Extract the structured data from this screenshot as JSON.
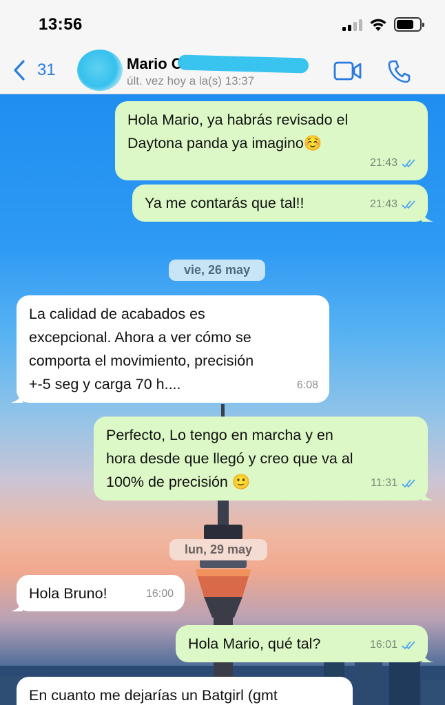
{
  "status_bar": {
    "time": "13:56"
  },
  "header": {
    "back_count": "31",
    "contact_name": "Mario C",
    "last_seen": "últ. vez hoy a la(s) 13:37"
  },
  "messages": [
    {
      "text": "Hola Mario, ya habrás revisado el\nDaytona panda ya imagino☺️",
      "time": "21:43",
      "direction": "out"
    },
    {
      "text": "Ya me contarás que tal!!",
      "time": "21:43",
      "direction": "out"
    },
    {
      "text": "La calidad de acabados es\nexcepcional. Ahora a ver cómo se\ncomporta el movimiento, precisión\n+-5 seg y carga 70 h....",
      "time": "6:08",
      "direction": "in"
    },
    {
      "text": "Perfecto, Lo tengo en marcha y en\nhora desde que llegó y creo que va al\n100% de precisión 🙂",
      "time": "11:31",
      "direction": "out"
    },
    {
      "text": "Hola Bruno!",
      "time": "16:00",
      "direction": "in"
    },
    {
      "text": "Hola Mario, qué tal?",
      "time": "16:01",
      "direction": "out"
    },
    {
      "text": "En cuanto me dejarías un Batgirl (gmt",
      "time": "",
      "direction": "in"
    }
  ],
  "date_separators": [
    {
      "label": "vie, 26 may"
    },
    {
      "label": "lun, 29 may"
    }
  ],
  "colors": {
    "accent": "#2a7be0",
    "outgoing_bubble": "#dcf8c6",
    "incoming_bubble": "#ffffff",
    "read_ticks": "#4fa3f0",
    "redaction": "#2ec1ee"
  }
}
